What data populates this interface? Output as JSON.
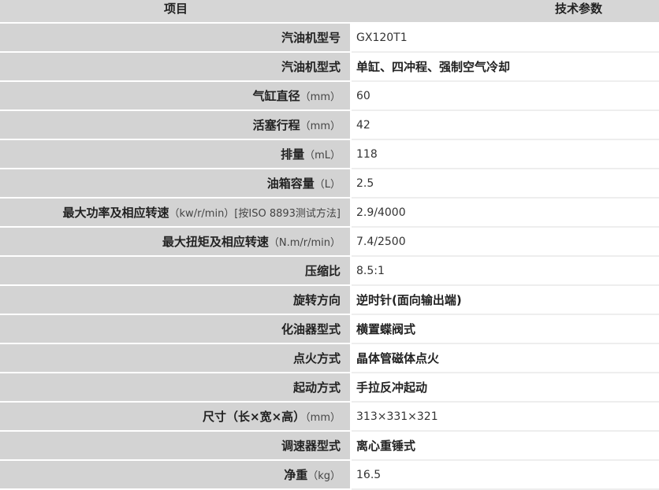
{
  "table": {
    "header": {
      "item": "项目",
      "spec": "技术参数"
    },
    "rows": [
      {
        "label": "汽油机型号",
        "unit": "",
        "value": "GX120T1"
      },
      {
        "label": "汽油机型式",
        "unit": "",
        "value": "单缸、四冲程、强制空气冷却"
      },
      {
        "label": "气缸直径",
        "unit": "（mm）",
        "value": "60"
      },
      {
        "label": "活塞行程",
        "unit": "（mm）",
        "value": "42"
      },
      {
        "label": "排量",
        "unit": "（mL）",
        "value": "118"
      },
      {
        "label": "油箱容量",
        "unit": "（L）",
        "value": "2.5"
      },
      {
        "label": "最大功率及相应转速",
        "unit": "（kw/r/min）[按ISO 8893测试方法]",
        "value": "2.9/4000"
      },
      {
        "label": "最大扭矩及相应转速",
        "unit": "（N.m/r/min）",
        "value": "7.4/2500"
      },
      {
        "label": "压缩比",
        "unit": "",
        "value": "8.5:1"
      },
      {
        "label": "旋转方向",
        "unit": "",
        "value": "逆时针(面向输出端)"
      },
      {
        "label": "化油器型式",
        "unit": "",
        "value": "横置蝶阀式"
      },
      {
        "label": "点火方式",
        "unit": "",
        "value": "晶体管磁体点火"
      },
      {
        "label": "起动方式",
        "unit": "",
        "value": "手拉反冲起动"
      },
      {
        "label": "尺寸（长×宽×高）",
        "unit": "（mm）",
        "value": "313×331×321"
      },
      {
        "label": "调速器型式",
        "unit": "",
        "value": "离心重锤式"
      },
      {
        "label": "净重",
        "unit": "（kg）",
        "value": "16.5"
      }
    ]
  }
}
